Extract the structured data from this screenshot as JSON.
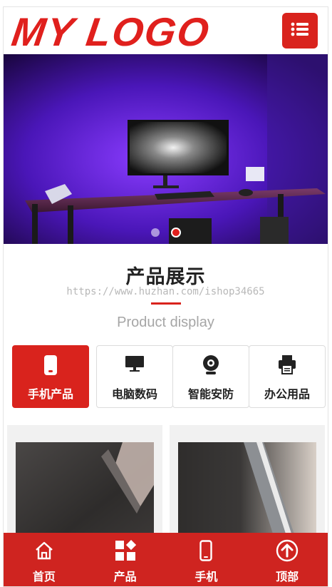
{
  "header": {
    "logo_text": "MY LOGO"
  },
  "section": {
    "title": "产品展示",
    "watermark": "https://www.huzhan.com/ishop34665",
    "subtitle": "Product display"
  },
  "categories": [
    {
      "label": "手机产品",
      "icon": "phone-icon",
      "active": true
    },
    {
      "label": "电脑数码",
      "icon": "monitor-icon",
      "active": false
    },
    {
      "label": "智能安防",
      "icon": "webcam-icon",
      "active": false
    },
    {
      "label": "办公用品",
      "icon": "printer-icon",
      "active": false
    }
  ],
  "bottom_nav": [
    {
      "label": "首页",
      "icon": "home-icon"
    },
    {
      "label": "产品",
      "icon": "grid-icon"
    },
    {
      "label": "手机",
      "icon": "phone-icon"
    },
    {
      "label": "顶部",
      "icon": "arrow-up-circle-icon"
    }
  ],
  "colors": {
    "brand": "#d9231d",
    "banner_bg": "#2a0a66"
  }
}
